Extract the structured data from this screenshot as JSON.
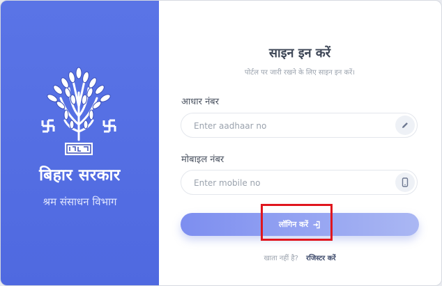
{
  "sidebar": {
    "title": "बिहार सरकार",
    "department": "श्रम संसाधन विभाग",
    "emblem_icon": "bihar-bodhi-tree-emblem",
    "emblem_text": "शान्ति"
  },
  "form": {
    "title": "साइन इन करें",
    "subtitle": "पोर्टल पर जारी रखने के लिए साइन इन करें।",
    "aadhaar": {
      "label": "आधार नंबर",
      "placeholder": "Enter aadhaar no",
      "icon": "pencil-icon"
    },
    "mobile": {
      "label": "मोबाइल नंबर",
      "placeholder": "Enter mobile no",
      "icon": "mobile-icon"
    },
    "login_button": "लॉगिन करें",
    "login_icon": "sign-in-icon",
    "register_prompt": "खाता नहीं है?",
    "register_link": "रजिस्टर करें"
  },
  "colors": {
    "sidebar_bg": "#5a74e6",
    "button_gradient_start": "#7d8ef0",
    "button_gradient_end": "#aab7f3",
    "highlight_border": "#e0161d"
  }
}
